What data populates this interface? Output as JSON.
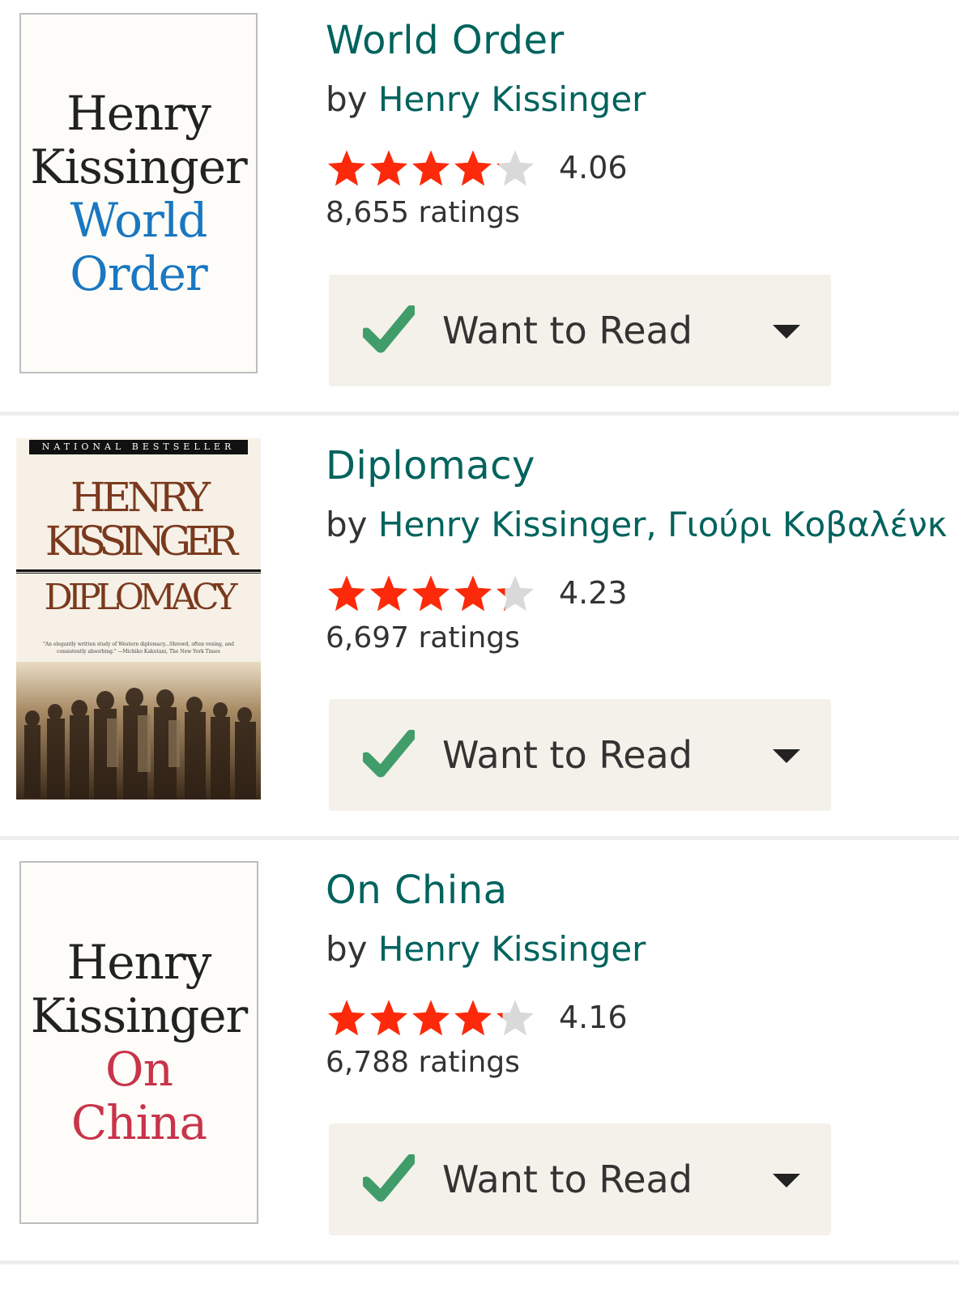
{
  "books": [
    {
      "cover": {
        "author_line1": "Henry",
        "author_line2": "Kissinger",
        "title_line1": "World",
        "title_line2": "Order"
      },
      "title": "World Order",
      "by": "by",
      "authors": "Henry Kissinger",
      "rating": 4.06,
      "rating_text": "4.06",
      "ratings_count": "8,655 ratings",
      "shelf_label": "Want to Read"
    },
    {
      "cover": {
        "banner": "NATIONAL BESTSELLER",
        "author_line1": "HENRY",
        "author_line2": "KISSINGER",
        "title_line1": "DIPLOMACY",
        "quote": "\"An elegantly written study of Western diplomacy...Shrewd, often vexing, and consistently absorbing.\" —Michiko Kakutani, The New York Times"
      },
      "title": "Diplomacy",
      "by": "by",
      "authors": "Henry Kissinger, Γιούρι Κοβαλένκ",
      "rating": 4.23,
      "rating_text": "4.23",
      "ratings_count": "6,697 ratings",
      "shelf_label": "Want to Read"
    },
    {
      "cover": {
        "author_line1": "Henry",
        "author_line2": "Kissinger",
        "title_line1": "On",
        "title_line2": "China"
      },
      "title": "On China",
      "by": "by",
      "authors": "Henry Kissinger",
      "rating": 4.16,
      "rating_text": "4.16",
      "ratings_count": "6,788 ratings",
      "shelf_label": "Want to Read"
    }
  ],
  "colors": {
    "link_green": "#00635d",
    "star_filled": "#fc2a0a",
    "star_empty": "#d9d9d9",
    "check_green": "#409d69",
    "button_bg": "#f4f1ea",
    "world_order_title": "#1a77c1",
    "on_china_title": "#c8344a",
    "diplomacy_brown": "#7a3a1e"
  },
  "icons": {
    "star": "star-icon",
    "check": "checkmark-icon",
    "dropdown": "dropdown-caret-icon"
  }
}
